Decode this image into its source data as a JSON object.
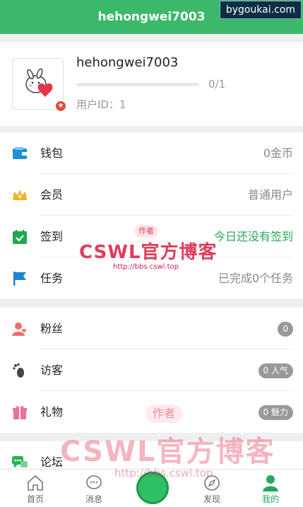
{
  "header": {
    "title": "hehongwei7003"
  },
  "watermark_top": "bygoukai.com",
  "profile": {
    "username": "hehongwei7003",
    "progress_text": "0/1",
    "progress_fraction": 0,
    "user_id": "用户ID：1"
  },
  "menu_group_1": [
    {
      "label": "钱包",
      "value": "0金币",
      "icon": "wallet-icon"
    },
    {
      "label": "会员",
      "value": "普通用户",
      "icon": "crown-icon"
    },
    {
      "label": "签到",
      "value": "今日还没有签到",
      "icon": "calendar-check-icon"
    },
    {
      "label": "任务",
      "value": "已完成0个任务",
      "icon": "flag-icon"
    }
  ],
  "menu_group_2": [
    {
      "label": "粉丝",
      "badge": "0",
      "icon": "fans-icon"
    },
    {
      "label": "访客",
      "badge": "0 人气",
      "icon": "footprint-icon"
    },
    {
      "label": "礼物",
      "badge": "0 魅力",
      "icon": "gift-icon"
    }
  ],
  "menu_group_3": [
    {
      "label": "论坛",
      "icon": "chat-bubbles-icon"
    }
  ],
  "tabbar": [
    {
      "label": "首页",
      "icon": "home-icon"
    },
    {
      "label": "消息",
      "icon": "message-icon"
    },
    {
      "label": "发现",
      "icon": "compass-icon"
    },
    {
      "label": "我的",
      "icon": "user-icon"
    }
  ],
  "watermark": {
    "brand": "CSWL官方博客",
    "url": "http://bbs.cswl.top",
    "tag": "作者"
  },
  "colors": {
    "accent": "#3cb86a",
    "sign_green": "#27a85a",
    "badge_gray": "#999999"
  }
}
